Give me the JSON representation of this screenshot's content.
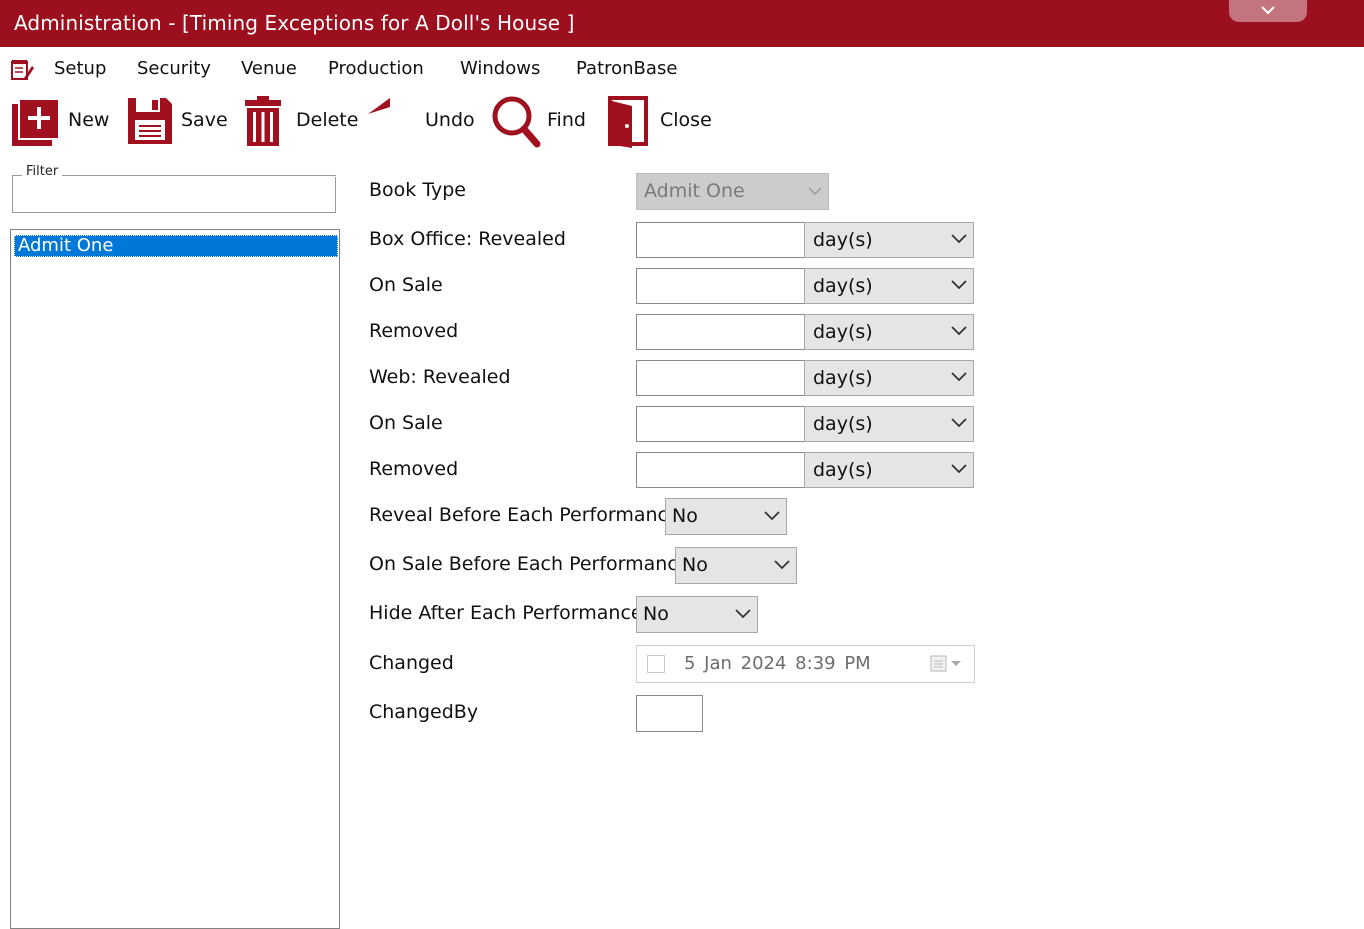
{
  "window": {
    "title": "Administration - [Timing Exceptions for A Doll's House ]",
    "accent_color": "#9b0f1f"
  },
  "menu": {
    "app_icon": "notepad-icon",
    "items": [
      "Setup",
      "Security",
      "Venue",
      "Production",
      "Windows",
      "PatronBase"
    ]
  },
  "toolbar": {
    "new_label": "New",
    "save_label": "Save",
    "delete_label": "Delete",
    "undo_label": "Undo",
    "find_label": "Find",
    "close_label": "Close"
  },
  "filter": {
    "legend": "Filter",
    "value": ""
  },
  "list": {
    "items": [
      {
        "label": "Admit One",
        "selected": true
      }
    ]
  },
  "form": {
    "book_type": {
      "label": "Book Type",
      "value": "Admit One"
    },
    "box_office_revealed": {
      "label": "Box Office: Revealed",
      "value": "",
      "unit": "day(s)"
    },
    "box_office_on_sale": {
      "label": "On Sale",
      "value": "",
      "unit": "day(s)"
    },
    "box_office_removed": {
      "label": "Removed",
      "value": "",
      "unit": "day(s)"
    },
    "web_revealed": {
      "label": "Web: Revealed",
      "value": "",
      "unit": "day(s)"
    },
    "web_on_sale": {
      "label": "On Sale",
      "value": "",
      "unit": "day(s)"
    },
    "web_removed": {
      "label": "Removed",
      "value": "",
      "unit": "day(s)"
    },
    "reveal_before_each": {
      "label": "Reveal Before Each Performance",
      "value": "No"
    },
    "on_sale_before_each": {
      "label": "On Sale Before Each Performance",
      "value": "No"
    },
    "hide_after_each": {
      "label": "Hide After Each Performance",
      "value": "No"
    },
    "changed": {
      "label": "Changed",
      "value": "5  Jan  2024   8:39 PM",
      "checked": false
    },
    "changed_by": {
      "label": "ChangedBy",
      "value": ""
    }
  }
}
